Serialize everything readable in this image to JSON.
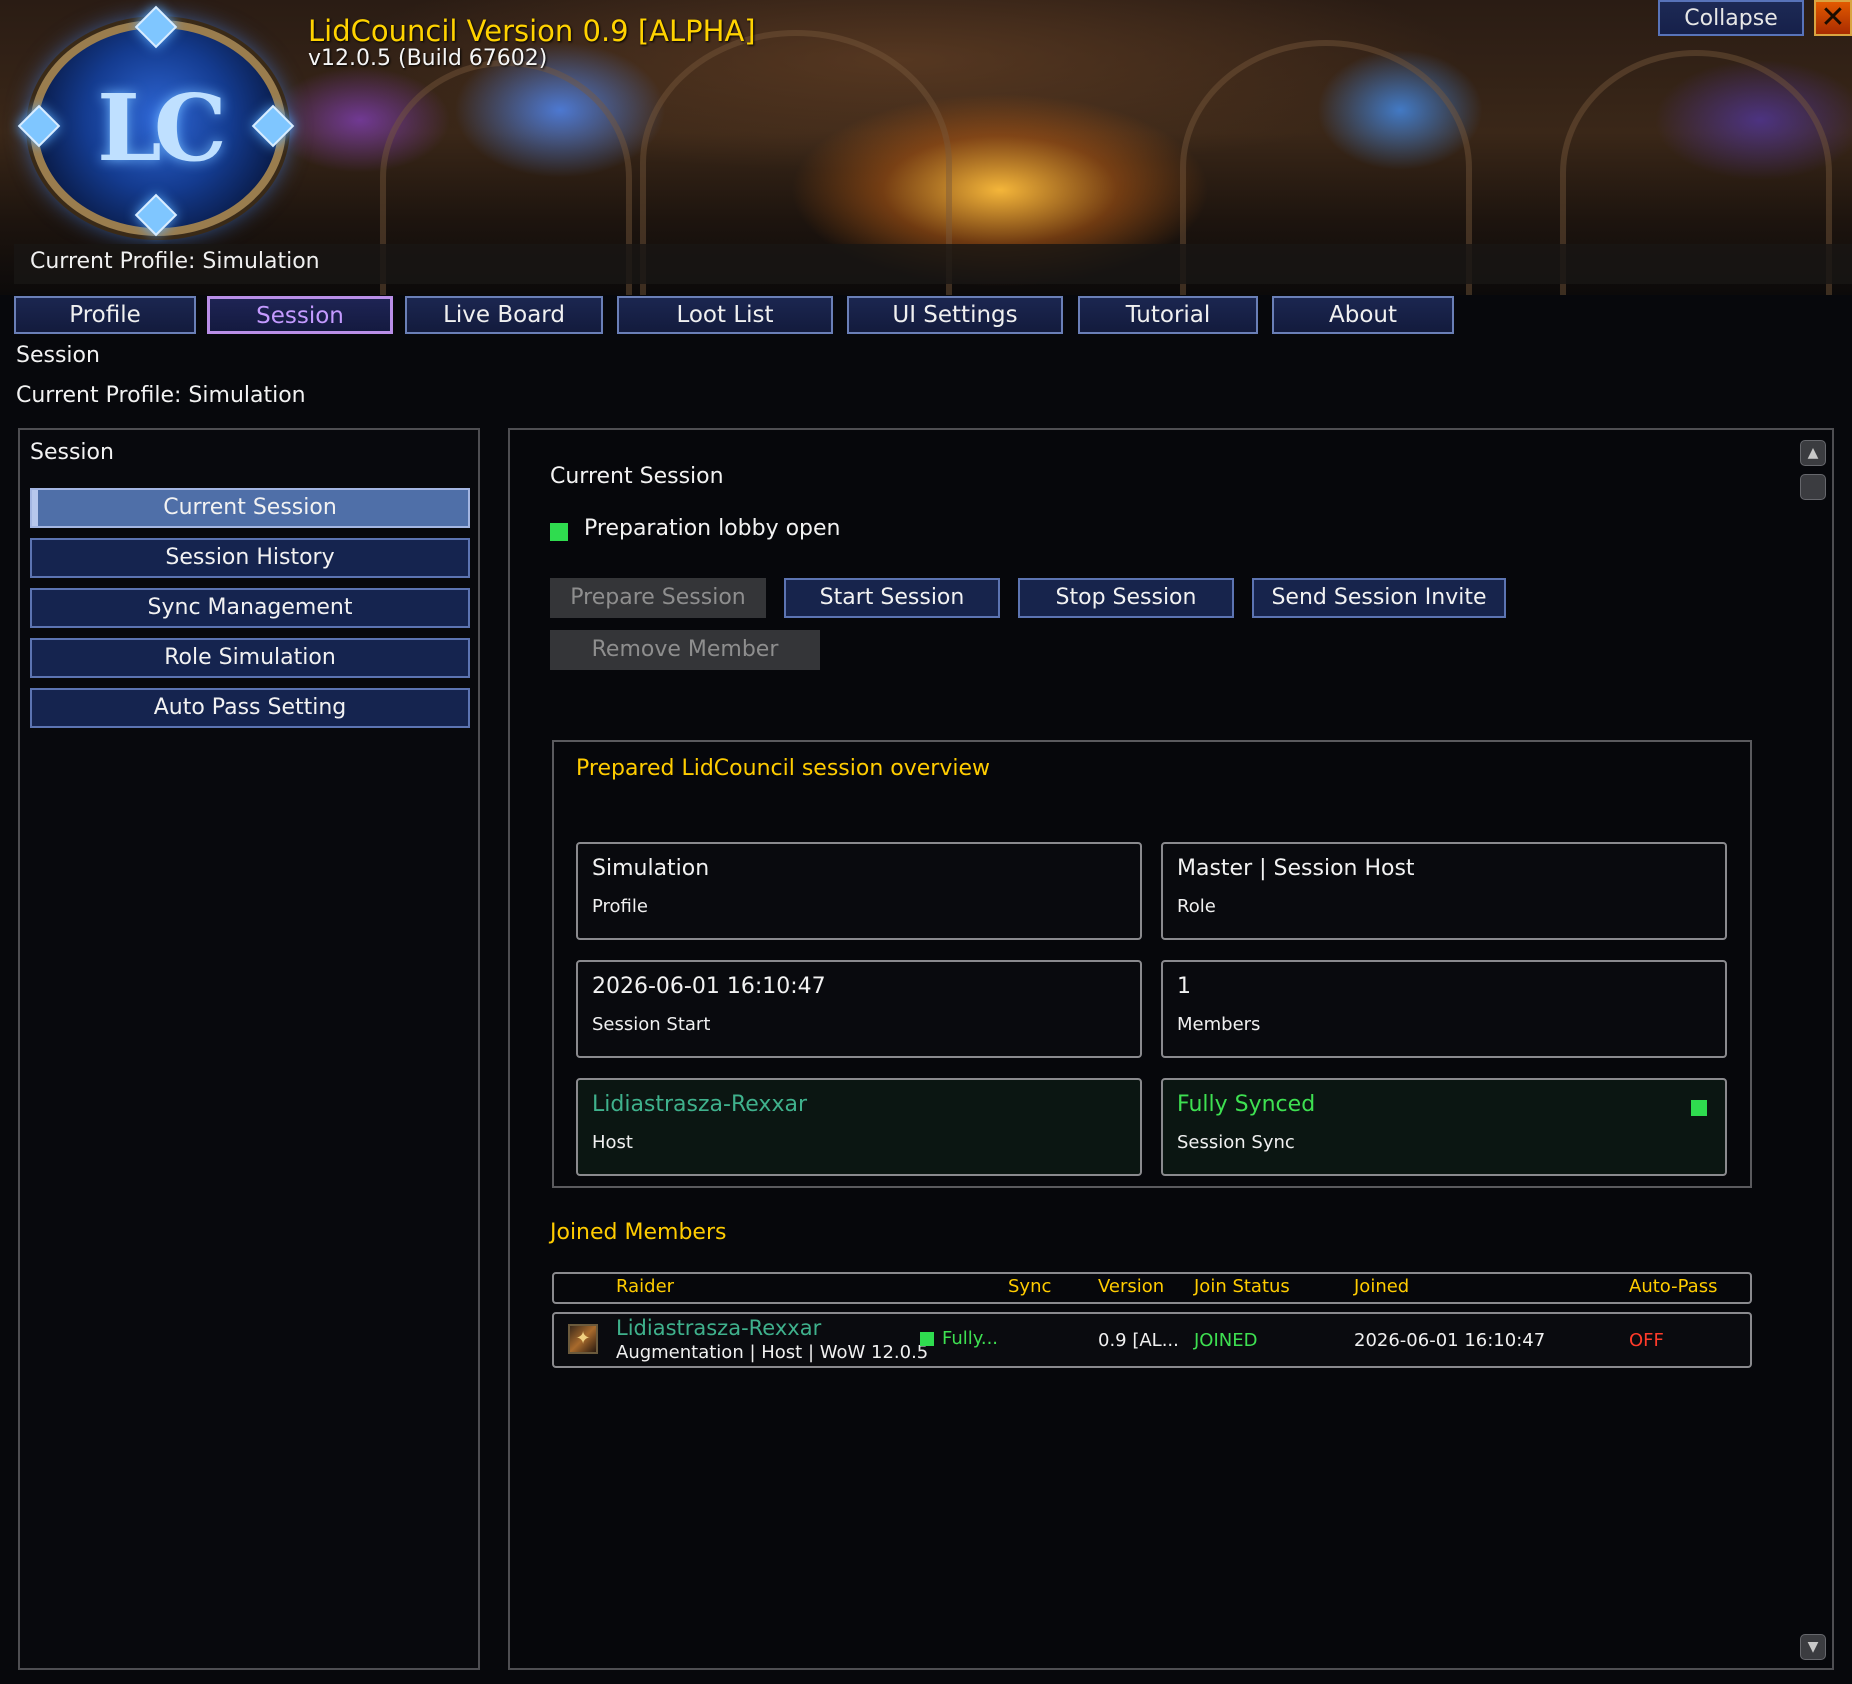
{
  "window": {
    "title": "LidCouncil Version 0.9 [ALPHA]",
    "version": "v12.0.5 (Build 67602)",
    "logo_text": "LC",
    "current_profile": "Current Profile: Simulation",
    "collapse_label": "Collapse",
    "close_label": "✕"
  },
  "tabs": [
    {
      "label": "Profile",
      "active": false
    },
    {
      "label": "Session",
      "active": true
    },
    {
      "label": "Live Board",
      "active": false
    },
    {
      "label": "Loot List",
      "active": false
    },
    {
      "label": "UI Settings",
      "active": false
    },
    {
      "label": "Tutorial",
      "active": false
    },
    {
      "label": "About",
      "active": false
    }
  ],
  "section": {
    "title": "Session",
    "profile": "Current Profile: Simulation"
  },
  "sidebar": {
    "title": "Session",
    "items": [
      {
        "label": "Current Session",
        "active": true
      },
      {
        "label": "Session History",
        "active": false
      },
      {
        "label": "Sync Management",
        "active": false
      },
      {
        "label": "Role Simulation",
        "active": false
      },
      {
        "label": "Auto Pass Setting",
        "active": false
      }
    ]
  },
  "main": {
    "title": "Current Session",
    "status": "Preparation lobby open",
    "buttons": [
      {
        "label": "Prepare Session",
        "enabled": false
      },
      {
        "label": "Start Session",
        "enabled": true
      },
      {
        "label": "Stop Session",
        "enabled": true
      },
      {
        "label": "Send Session Invite",
        "enabled": true
      },
      {
        "label": "Remove Member",
        "enabled": false
      }
    ],
    "overview": {
      "title": "Prepared LidCouncil session overview",
      "cards": [
        {
          "value": "Simulation",
          "label": "Profile"
        },
        {
          "value": "Master | Session Host",
          "label": "Role"
        },
        {
          "value": "2026-06-01 16:10:47",
          "label": "Session Start"
        },
        {
          "value": "1",
          "label": "Members"
        },
        {
          "value": "Lidiastrasza-Rexxar",
          "label": "Host"
        },
        {
          "value": "Fully Synced",
          "label": "Session Sync"
        }
      ]
    },
    "members": {
      "title": "Joined Members",
      "columns": [
        "Raider",
        "Sync",
        "Version",
        "Join Status",
        "Joined",
        "Auto-Pass"
      ],
      "rows": [
        {
          "name": "Lidiastrasza-Rexxar",
          "details": "Augmentation | Host | WoW 12.0.5",
          "sync": "Fully...",
          "version": "0.9 [AL...",
          "join_status": "JOINED",
          "joined": "2026-06-01 16:10:47",
          "auto_pass": "OFF"
        }
      ]
    }
  },
  "colors": {
    "gold": "#ffcc00",
    "teal_name": "#3fb18c",
    "green_status": "#2fdc4f",
    "red_off": "#ff3b2a",
    "active_tab": "#c49aff"
  }
}
